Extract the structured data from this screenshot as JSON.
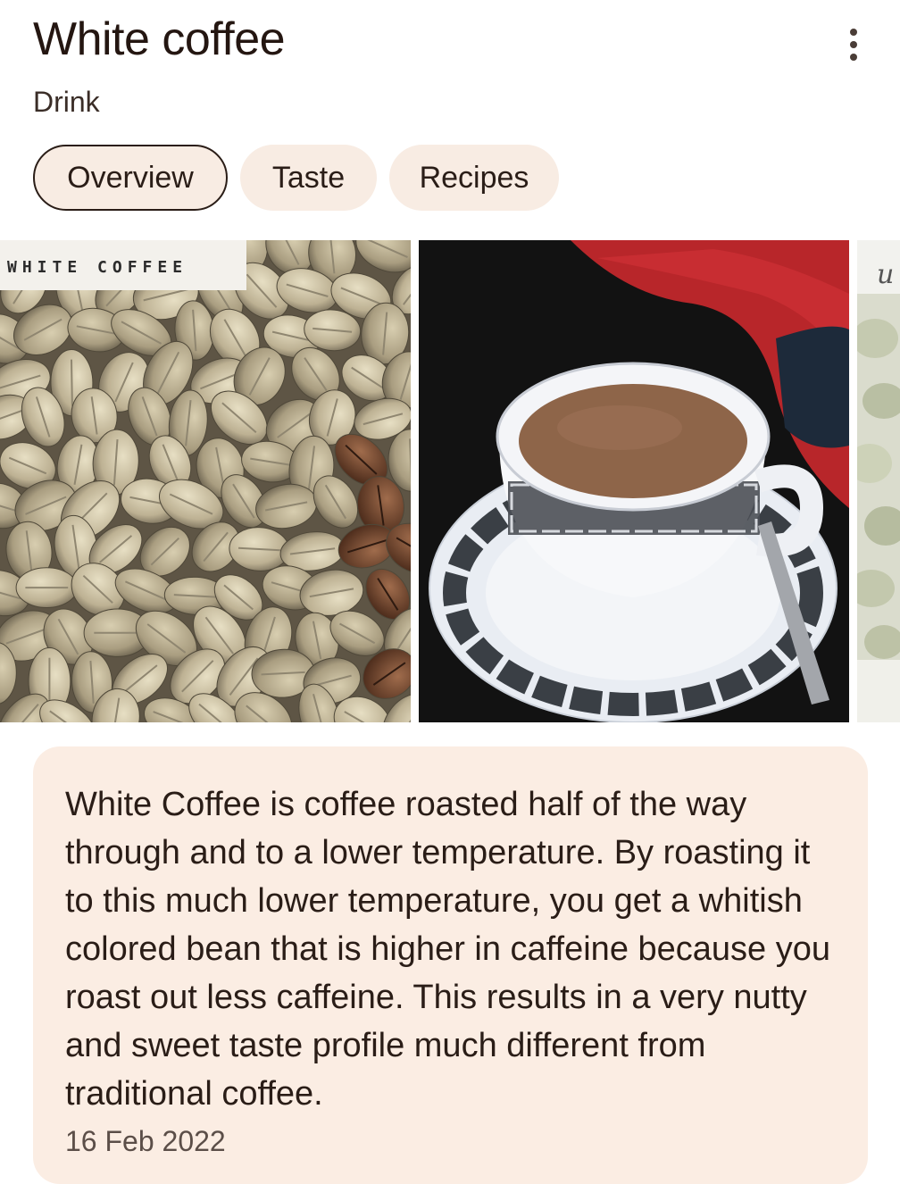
{
  "header": {
    "title": "White coffee",
    "subtitle": "Drink"
  },
  "tabs": [
    {
      "label": "Overview",
      "active": true
    },
    {
      "label": "Taste",
      "active": false
    },
    {
      "label": "Recipes",
      "active": false
    }
  ],
  "gallery": {
    "images": [
      {
        "caption": "WHITE COFFEE"
      },
      {
        "caption": ""
      },
      {
        "caption": ""
      }
    ]
  },
  "description": {
    "text": "White Coffee is coffee roasted half of the way through and to a lower temperature. By roasting it to this much lower temperature, you get a whitish colored bean that is higher in caffeine because you roast out less caffeine. This results in a very nutty and sweet taste profile much different from traditional coffee.",
    "date": "16 Feb 2022"
  },
  "colors": {
    "accent": "#f8ece3",
    "card": "#fbede3",
    "text": "#2a1d17"
  },
  "icons": {
    "more": "more-vert-icon"
  }
}
